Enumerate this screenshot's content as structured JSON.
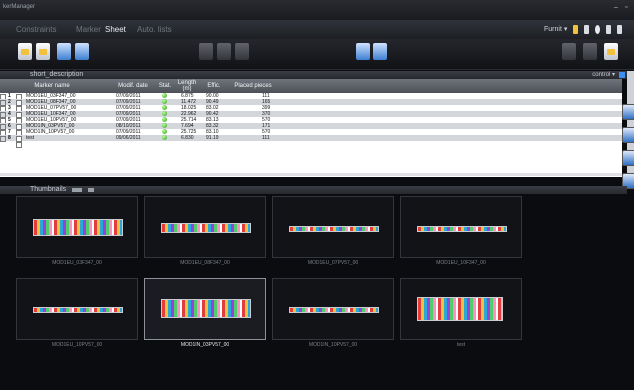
{
  "window": {
    "title": "kerManager"
  },
  "tabs": [
    {
      "label": "Constraints"
    },
    {
      "label": "Marker"
    },
    {
      "label": "Sheet"
    },
    {
      "label": "Auto. lists"
    }
  ],
  "active_tab": "Sheet",
  "furnit_label": "Furnit",
  "description_panel": {
    "title": "short_description",
    "control_label": "control"
  },
  "table": {
    "headers": {
      "marker_name": "Marker name",
      "modif_date": "Modif. date",
      "stat": "Stat.",
      "length": "Length",
      "length_unit": "(m)",
      "effic": "Effic.",
      "placed_pieces": "Placed pieces"
    },
    "rows": [
      {
        "n": "1",
        "name": "MOD1EU_03F347_00",
        "date": "07/09/2011",
        "length": "6.875",
        "effic": "90.00",
        "pieces": "111"
      },
      {
        "n": "2",
        "name": "MOD1EU_08F347_00",
        "date": "07/09/2011",
        "length": "11.472",
        "effic": "90.49",
        "pieces": "165"
      },
      {
        "n": "3",
        "name": "MOD1EU_07PV57_00",
        "date": "07/09/2011",
        "length": "18.025",
        "effic": "83.02",
        "pieces": "399"
      },
      {
        "n": "4",
        "name": "MOD1EU_10F347_00",
        "date": "07/09/2011",
        "length": "22.962",
        "effic": "90.42",
        "pieces": "370"
      },
      {
        "n": "5",
        "name": "MOD1EU_10PV57_00",
        "date": "07/09/2011",
        "length": "25.714",
        "effic": "83.13",
        "pieces": "570"
      },
      {
        "n": "6",
        "name": "MOD1IN_03PV57_00",
        "date": "08/10/2011",
        "length": "7.694",
        "effic": "83.32",
        "pieces": "171"
      },
      {
        "n": "7",
        "name": "MOD1IN_10PV57_00",
        "date": "07/09/2011",
        "length": "25.725",
        "effic": "83.10",
        "pieces": "570"
      },
      {
        "n": "8",
        "name": "test",
        "date": "09/06/2011",
        "length": "6.830",
        "effic": "91.19",
        "pieces": "111"
      }
    ]
  },
  "thumbnails_panel": {
    "title": "Thumbnails"
  },
  "thumbnails": [
    {
      "caption": "MOD1EU_03F347_00"
    },
    {
      "caption": "MOD1EU_08F347_00"
    },
    {
      "caption": "MOD1EU_07PV57_00"
    },
    {
      "caption": "MOD1EU_10F347_00"
    },
    {
      "caption": "MOD1EU_10PV57_00"
    },
    {
      "caption": "MOD1IN_03PV57_00"
    },
    {
      "caption": "MOD1IN_10PV57_00"
    },
    {
      "caption": "test"
    }
  ],
  "colors": {
    "accent": "#3d8ef0",
    "status_ok": "#2d9a17",
    "title_bar": "#1a1b20"
  },
  "icons": [
    "minimize-icon",
    "close-icon",
    "new-document-icon",
    "open-document-icon",
    "save-icon",
    "export-icon",
    "cut-icon",
    "copy-icon",
    "paste-icon",
    "import-icon",
    "print-icon"
  ]
}
